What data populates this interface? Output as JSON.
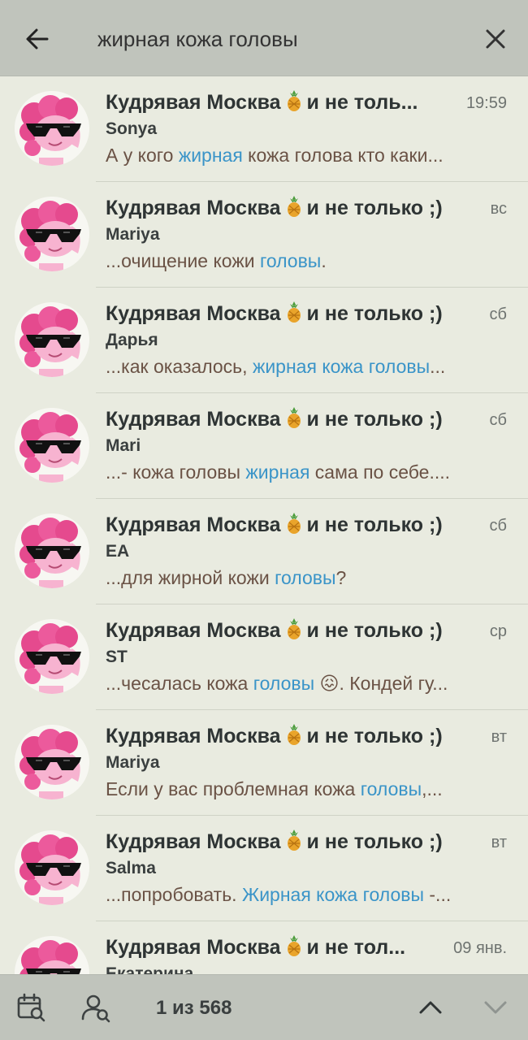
{
  "search": {
    "query": "жирная кожа головы",
    "back_icon": "arrow-left-icon",
    "close_icon": "close-icon"
  },
  "results": [
    {
      "title_a": "Кудрявая Москва",
      "title_b": "и не толь...",
      "date": "19:59",
      "sender": "Sonya",
      "snippet": [
        {
          "t": "А у кого "
        },
        {
          "t": "жирная",
          "h": true
        },
        {
          "t": " кожа голова кто каки..."
        }
      ]
    },
    {
      "title_a": "Кудрявая Москва",
      "title_b": "и не только ;)",
      "date": "вс",
      "sender": "Mariya",
      "snippet": [
        {
          "t": "...очищение кожи "
        },
        {
          "t": "головы",
          "h": true
        },
        {
          "t": "."
        }
      ]
    },
    {
      "title_a": "Кудрявая Москва",
      "title_b": "и не только ;)",
      "date": "сб",
      "sender": "Дарья",
      "snippet": [
        {
          "t": "...как оказалось, "
        },
        {
          "t": "жирная кожа головы",
          "h": true
        },
        {
          "t": "..."
        }
      ]
    },
    {
      "title_a": "Кудрявая Москва",
      "title_b": "и не только ;)",
      "date": "сб",
      "sender": "Mari",
      "snippet": [
        {
          "t": "...- кожа головы "
        },
        {
          "t": "жирная",
          "h": true
        },
        {
          "t": " сама по себе...."
        }
      ]
    },
    {
      "title_a": "Кудрявая Москва",
      "title_b": "и не только ;)",
      "date": "сб",
      "sender": "EA",
      "snippet": [
        {
          "t": "...для жирной кожи "
        },
        {
          "t": "головы",
          "h": true
        },
        {
          "t": "?"
        }
      ]
    },
    {
      "title_a": "Кудрявая Москва",
      "title_b": "и не только ;)",
      "date": "ср",
      "sender": "ST",
      "snippet": [
        {
          "t": "...чесалась кожа "
        },
        {
          "t": "головы",
          "h": true
        },
        {
          "t": " 😖. Кондей гу..."
        }
      ]
    },
    {
      "title_a": "Кудрявая Москва",
      "title_b": "и не только ;)",
      "date": "вт",
      "sender": "Mariya",
      "snippet": [
        {
          "t": "Если у вас проблемная кожа "
        },
        {
          "t": "головы",
          "h": true
        },
        {
          "t": ",..."
        }
      ]
    },
    {
      "title_a": "Кудрявая Москва",
      "title_b": "и не только ;)",
      "date": "вт",
      "sender": "Salma",
      "snippet": [
        {
          "t": "...попробовать. "
        },
        {
          "t": "Жирная кожа головы",
          "h": true
        },
        {
          "t": " -..."
        }
      ]
    },
    {
      "title_a": "Кудрявая Москва",
      "title_b": "и не тол...",
      "date": "09 янв.",
      "sender": "Екатерина",
      "snippet": []
    }
  ],
  "bottom": {
    "counter": "1 из 568",
    "calendar_icon": "calendar-search-icon",
    "user_icon": "user-search-icon",
    "up_icon": "chevron-up-icon",
    "down_icon": "chevron-down-icon"
  },
  "colors": {
    "bar": "#c0c4bc",
    "background": "#e9ebe0",
    "highlight": "#3a94c8",
    "snippet": "#6a5245"
  }
}
